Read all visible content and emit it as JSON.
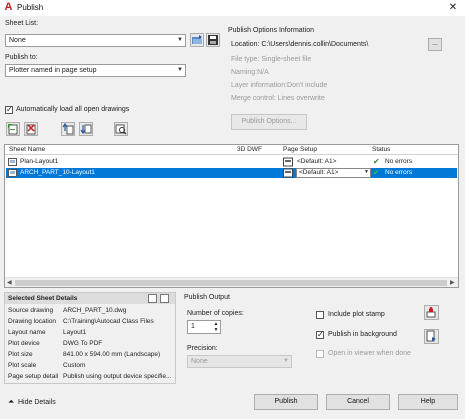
{
  "window": {
    "title": "Publish"
  },
  "sheet_list": {
    "label": "Sheet List:",
    "value": "None"
  },
  "publish_to": {
    "label": "Publish to:",
    "value": "Plotter named in page setup"
  },
  "auto_load": {
    "label": "Automatically load all open drawings",
    "checked": true
  },
  "publish_info": {
    "title": "Publish Options Information",
    "location": "Location: C:\\Users\\dennis.collin\\Documents\\",
    "file_type": "File type: Single-sheet file",
    "naming": "Naming:N/A",
    "layer_info": "Layer information:Don't include",
    "merge_control": "Merge control: Lines overwrite",
    "options_button": "Publish Options...",
    "browse_button": "..."
  },
  "table": {
    "headers": {
      "sheet_name": "Sheet Name",
      "dwf3d": "3D DWF",
      "page_setup": "Page Setup",
      "status": "Status"
    },
    "rows": [
      {
        "name": "Plan-Layout1",
        "page_setup": "<Default: A1>",
        "status": "No errors"
      },
      {
        "name": "ARCH_PART_10-Layout1",
        "page_setup": "<Default: A1>",
        "status": "No errors"
      }
    ]
  },
  "details": {
    "title": "Selected Sheet Details",
    "fields": [
      {
        "label": "Source drawing",
        "value": "ARCH_PART_10.dwg"
      },
      {
        "label": "Drawing location",
        "value": "C:\\Training\\Autocad Class Files"
      },
      {
        "label": "Layout name",
        "value": "Layout1"
      },
      {
        "label": "Plot device",
        "value": "DWG To PDF"
      },
      {
        "label": "Plot size",
        "value": "841.00 x 594.00 mm (Landscape)"
      },
      {
        "label": "Plot scale",
        "value": "Custom"
      },
      {
        "label": "Page setup detail",
        "value": "Publish using output device specifie..."
      }
    ]
  },
  "output": {
    "title": "Publish Output",
    "copies_label": "Number of copies:",
    "copies_value": "1",
    "precision_label": "Precision:",
    "precision_value": "None",
    "include_stamp": {
      "label": "Include plot stamp",
      "checked": false
    },
    "in_background": {
      "label": "Publish in background",
      "checked": true
    },
    "open_viewer": {
      "label": "Open in viewer when done",
      "checked": false
    }
  },
  "footer": {
    "hide_details": "Hide Details",
    "publish": "Publish",
    "cancel": "Cancel",
    "help": "Help"
  },
  "colors": {
    "selection": "#0078d7",
    "ok_check": "#2e8b2e",
    "app_red": "#c41f1f"
  }
}
